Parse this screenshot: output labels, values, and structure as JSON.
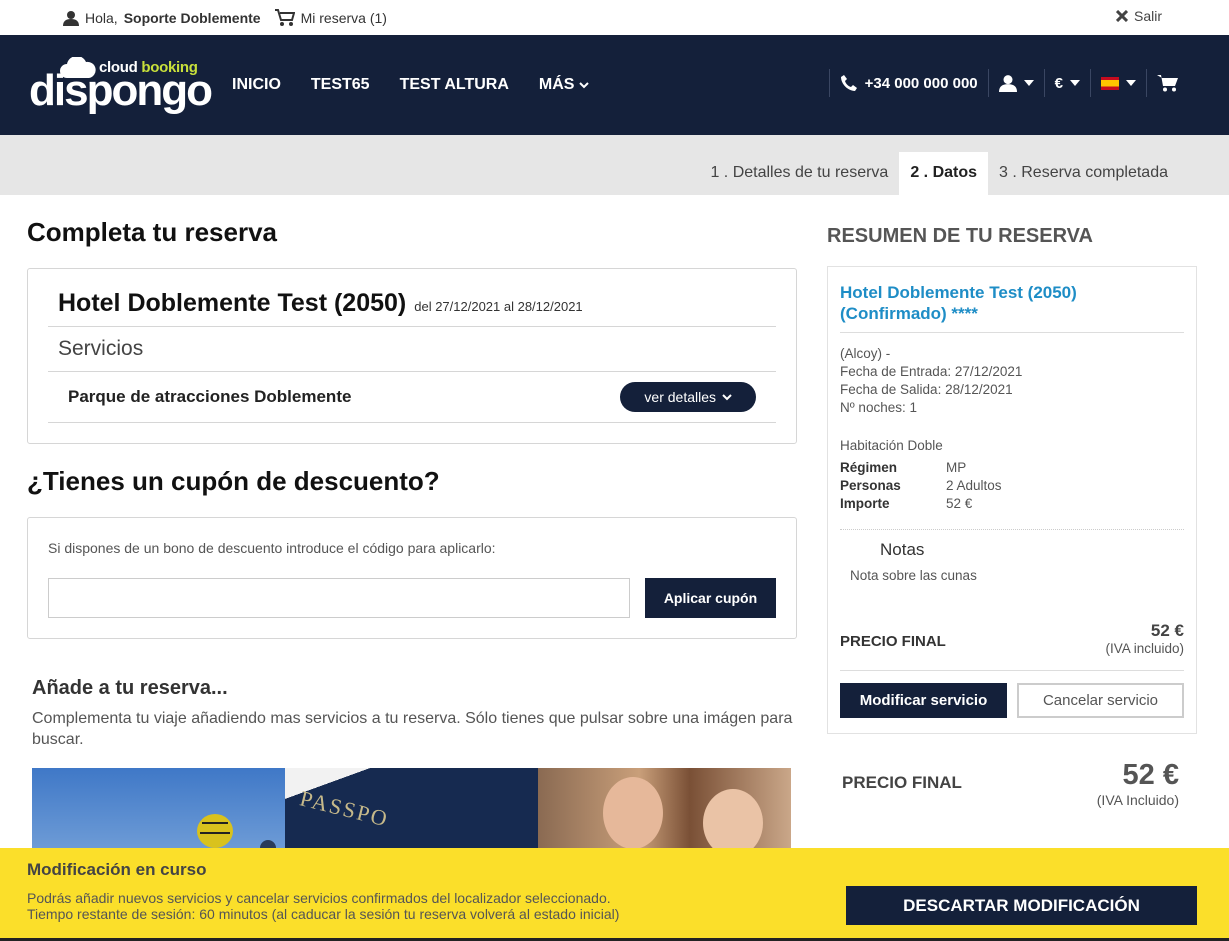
{
  "topbar": {
    "greeting": "Hola,",
    "user": "Soporte Doblemente",
    "cart": "Mi reserva (1)",
    "logout": "Salir"
  },
  "logo": {
    "cloud": "cloud",
    "booking": "booking",
    "brand": "dispongo"
  },
  "nav": {
    "items": [
      "INICIO",
      "TEST65",
      "TEST ALTURA",
      "MÁS"
    ],
    "phone": "+34 000 000 000",
    "currency": "€"
  },
  "steps": [
    "1 . Detalles de tu reserva",
    "2 . Datos",
    "3 . Reserva completada"
  ],
  "main": {
    "title": "Completa tu reserva",
    "hotel_name": "Hotel Doblemente Test (2050)",
    "hotel_dates": "del 27/12/2021 al 28/12/2021",
    "services_label": "Servicios",
    "service_name": "Parque de atracciones Doblemente",
    "details_button": "ver detalles",
    "coupon_title": "¿Tienes un cupón de descuento?",
    "coupon_text": "Si dispones de un bono de descuento introduce el código para aplicarlo:",
    "coupon_value": "",
    "coupon_button": "Aplicar cupón",
    "add_title": "Añade a tu reserva...",
    "add_text": "Complementa tu viaje añadiendo mas servicios a tu reserva. Sólo tienes que pulsar sobre una imágen para buscar.",
    "passport_text": "PASSPO"
  },
  "summary": {
    "title": "RESUMEN DE TU RESERVA",
    "hotel": "Hotel Doblemente Test (2050) (Confirmado) ****",
    "location": "(Alcoy) -",
    "checkin": "Fecha de Entrada: 27/12/2021",
    "checkout": "Fecha de Salida: 28/12/2021",
    "nights": "Nº noches: 1",
    "room": "Habitación Doble",
    "regimen_label": "Régimen",
    "regimen": "MP",
    "personas_label": "Personas",
    "personas": "2 Adultos",
    "importe_label": "Importe",
    "importe": "52 €",
    "notes_title": "Notas",
    "notes_text": "Nota sobre las cunas",
    "price_label": "PRECIO FINAL",
    "price": "52 €",
    "vat": "(IVA incluido)",
    "modify_button": "Modificar servicio",
    "cancel_button": "Cancelar servicio",
    "total_label": "PRECIO FINAL",
    "total": "52 €",
    "total_vat": "(IVA Incluido)"
  },
  "footer": {
    "title": "Modificación en curso",
    "line1": "Podrás añadir nuevos servicios y cancelar servicios confirmados del localizador seleccionado.",
    "line2": "Tiempo restante de sesión: 60 minutos (al caducar la sesión tu reserva volverá al estado inicial)",
    "button": "DESCARTAR MODIFICACIÓN"
  }
}
